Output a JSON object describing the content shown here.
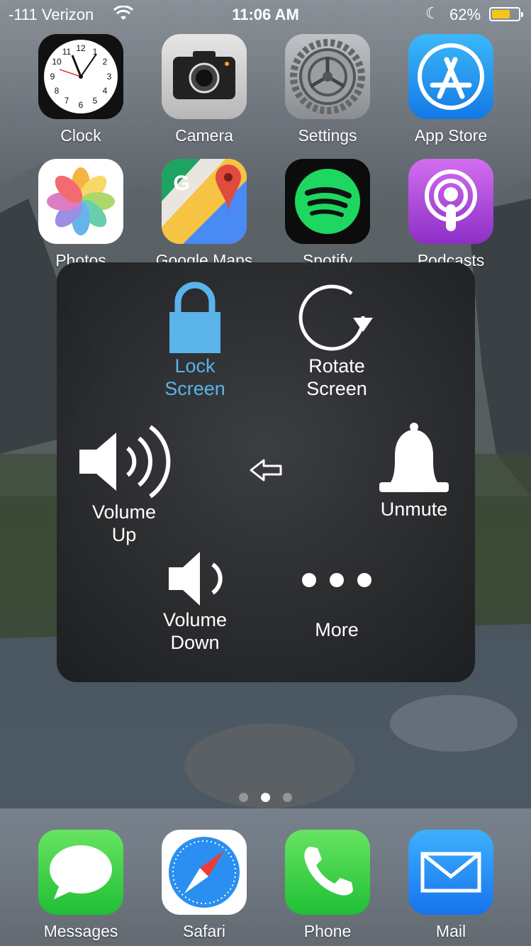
{
  "status_bar": {
    "carrier": "-111 Verizon",
    "time": "11:06 AM",
    "battery_percent": "62%",
    "battery_level": 0.62,
    "icons": [
      "wifi-icon",
      "moon-icon",
      "battery-icon"
    ]
  },
  "home_apps": [
    {
      "label": "Clock",
      "icon": "clock-icon"
    },
    {
      "label": "Camera",
      "icon": "camera-icon"
    },
    {
      "label": "Settings",
      "icon": "settings-gear-icon"
    },
    {
      "label": "App Store",
      "icon": "app-store-icon"
    },
    {
      "label": "Photos",
      "icon": "photos-icon"
    },
    {
      "label": "Google Maps",
      "icon": "google-maps-icon"
    },
    {
      "label": "Spotify",
      "icon": "spotify-icon"
    },
    {
      "label": "Podcasts",
      "icon": "podcasts-icon"
    }
  ],
  "clock_numbers": [
    "12",
    "1",
    "2",
    "3",
    "4",
    "5",
    "6",
    "7",
    "8",
    "9",
    "10",
    "11"
  ],
  "google_maps_letter": "G",
  "assistive_menu": {
    "lock": {
      "line1": "Lock",
      "line2": "Screen",
      "icon": "padlock-icon",
      "color": "#5ab4ea"
    },
    "rotate": {
      "line1": "Rotate",
      "line2": "Screen",
      "icon": "rotate-icon"
    },
    "volume_up": {
      "line1": "Volume",
      "line2": "Up",
      "icon": "speaker-loud-icon"
    },
    "back": {
      "icon": "back-arrow-icon"
    },
    "unmute": {
      "line1": "Unmute",
      "icon": "bell-icon"
    },
    "volume_down": {
      "line1": "Volume",
      "line2": "Down",
      "icon": "speaker-quiet-icon"
    },
    "more": {
      "line1": "More",
      "icon": "ellipsis-icon"
    }
  },
  "page_dots": {
    "count": 3,
    "active_index": 1
  },
  "dock_apps": [
    {
      "label": "Messages",
      "icon": "messages-icon"
    },
    {
      "label": "Safari",
      "icon": "safari-compass-icon"
    },
    {
      "label": "Phone",
      "icon": "phone-icon"
    },
    {
      "label": "Mail",
      "icon": "mail-icon"
    }
  ]
}
